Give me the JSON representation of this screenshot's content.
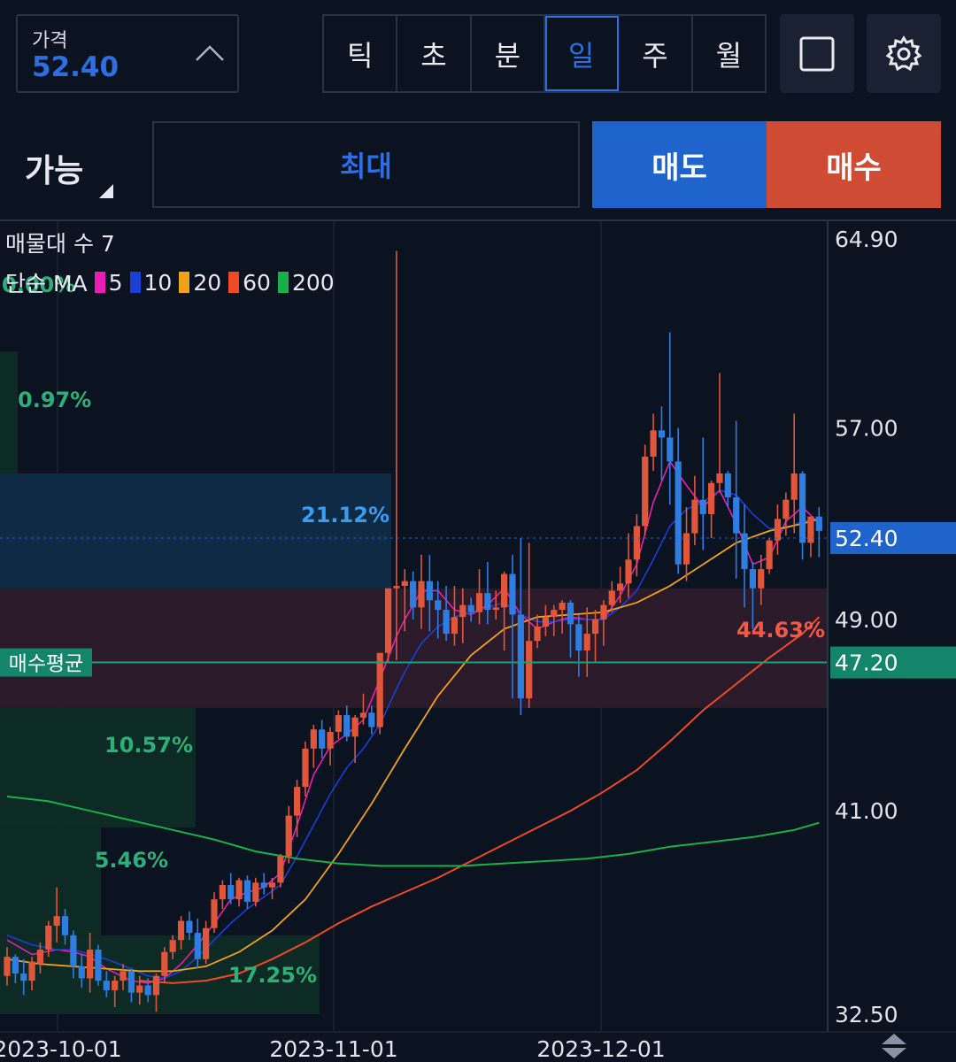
{
  "price_box": {
    "label": "가격",
    "value": "52.40"
  },
  "periods": [
    {
      "label": "틱",
      "active": false
    },
    {
      "label": "초",
      "active": false
    },
    {
      "label": "분",
      "active": false
    },
    {
      "label": "일",
      "active": true
    },
    {
      "label": "주",
      "active": false
    },
    {
      "label": "월",
      "active": false
    }
  ],
  "order": {
    "available_label": "가능",
    "max_label": "최대",
    "sell_label": "매도",
    "buy_label": "매수"
  },
  "legend": {
    "volume_profile": "매물대 수 7",
    "ma_label": "단순 MA",
    "ma_periods": [
      {
        "period": "5",
        "color": "#e91eb4"
      },
      {
        "period": "10",
        "color": "#1a3fd6"
      },
      {
        "period": "20",
        "color": "#f0a21a"
      },
      {
        "period": "60",
        "color": "#ef4a26"
      },
      {
        "period": "200",
        "color": "#18b04a"
      }
    ]
  },
  "colors": {
    "up": "#e0563a",
    "down": "#2f7de0",
    "accent": "#2d6fe0",
    "current_price_bg": "#1f64cc",
    "avg_price_bg": "#12856a"
  },
  "chart_data": {
    "type": "candlestick",
    "y_axis_ticks": [
      "64.90",
      "57.00",
      "49.00",
      "41.00",
      "32.50"
    ],
    "ylim": [
      32.5,
      64.9
    ],
    "x_axis_ticks": [
      "2023-10-01",
      "2023-11-01",
      "2023-12-01"
    ],
    "current_price": "52.40",
    "average_buy_price": {
      "label": "매수평균",
      "value": "47.20"
    },
    "volume_profile_labels": [
      "0.00%",
      "0.97%",
      "21.12%",
      "44.63%",
      "10.57%",
      "5.46%",
      "17.25%"
    ],
    "volume_profile": [
      {
        "from": 60.2,
        "to": 64.9,
        "percent": "0.00%",
        "color": "#0e2a24"
      },
      {
        "from": 55.1,
        "to": 60.2,
        "percent": "0.97%",
        "color": "#0e2a24"
      },
      {
        "from": 50.3,
        "to": 55.1,
        "percent": "21.12%",
        "color": "#0f2a45"
      },
      {
        "from": 45.3,
        "to": 50.3,
        "percent": "44.63%",
        "color": "#2a1a2a"
      },
      {
        "from": 40.3,
        "to": 45.3,
        "percent": "10.57%",
        "color": "#0e2a24"
      },
      {
        "from": 35.8,
        "to": 40.3,
        "percent": "5.46%",
        "color": "#0e2a24"
      },
      {
        "from": 32.5,
        "to": 35.8,
        "percent": "17.25%",
        "color": "#0e2a24"
      }
    ],
    "candles": [
      [
        34.1,
        35.3,
        33.7,
        34.9
      ],
      [
        34.9,
        35.0,
        33.8,
        34.2
      ],
      [
        34.2,
        34.8,
        33.3,
        33.9
      ],
      [
        33.9,
        34.9,
        33.5,
        34.7
      ],
      [
        34.6,
        35.5,
        34.2,
        35.2
      ],
      [
        35.2,
        36.4,
        34.9,
        36.2
      ],
      [
        36.2,
        37.8,
        35.5,
        36.6
      ],
      [
        36.6,
        36.9,
        35.4,
        35.8
      ],
      [
        35.8,
        36.0,
        34.0,
        34.5
      ],
      [
        34.5,
        35.0,
        33.6,
        34.0
      ],
      [
        34.0,
        35.9,
        33.4,
        35.2
      ],
      [
        35.2,
        35.4,
        33.7,
        33.9
      ],
      [
        33.9,
        34.3,
        33.2,
        33.5
      ],
      [
        33.5,
        34.1,
        32.8,
        33.9
      ],
      [
        33.9,
        34.6,
        33.5,
        34.3
      ],
      [
        34.3,
        34.4,
        33.0,
        33.4
      ],
      [
        33.4,
        34.1,
        32.9,
        33.7
      ],
      [
        33.7,
        34.0,
        33.0,
        33.3
      ],
      [
        33.3,
        34.2,
        32.6,
        34.1
      ],
      [
        34.1,
        35.3,
        33.8,
        35.1
      ],
      [
        35.1,
        35.8,
        34.8,
        35.6
      ],
      [
        35.6,
        36.6,
        35.2,
        36.4
      ],
      [
        36.4,
        36.8,
        35.6,
        35.9
      ],
      [
        35.9,
        36.5,
        34.4,
        34.8
      ],
      [
        34.8,
        36.4,
        34.6,
        36.1
      ],
      [
        36.1,
        37.6,
        35.9,
        37.3
      ],
      [
        37.3,
        38.1,
        36.9,
        37.9
      ],
      [
        37.9,
        38.4,
        37.1,
        37.3
      ],
      [
        37.3,
        38.2,
        37.0,
        38.1
      ],
      [
        38.1,
        38.3,
        36.9,
        37.2
      ],
      [
        37.2,
        38.2,
        37.0,
        38.0
      ],
      [
        38.0,
        38.4,
        37.5,
        37.8
      ],
      [
        37.8,
        38.2,
        37.3,
        38.0
      ],
      [
        38.0,
        39.2,
        37.8,
        39.1
      ],
      [
        39.1,
        41.2,
        38.8,
        40.8
      ],
      [
        40.8,
        42.3,
        39.9,
        42.0
      ],
      [
        42.0,
        43.9,
        41.6,
        43.6
      ],
      [
        43.6,
        44.6,
        42.8,
        44.4
      ],
      [
        44.4,
        44.8,
        43.2,
        43.6
      ],
      [
        43.6,
        44.5,
        42.9,
        44.3
      ],
      [
        44.3,
        45.2,
        44.0,
        45.0
      ],
      [
        45.0,
        45.4,
        43.9,
        44.1
      ],
      [
        44.1,
        45.0,
        43.0,
        44.9
      ],
      [
        44.9,
        45.9,
        44.6,
        45.1
      ],
      [
        45.1,
        45.4,
        44.2,
        44.5
      ],
      [
        44.5,
        47.6,
        44.2,
        47.6
      ],
      [
        47.6,
        50.3,
        47.2,
        50.3
      ],
      [
        50.3,
        64.4,
        47.3,
        50.4
      ],
      [
        50.4,
        51.1,
        48.5,
        50.6
      ],
      [
        50.6,
        51.0,
        49.0,
        49.5
      ],
      [
        49.5,
        51.7,
        48.6,
        50.6
      ],
      [
        50.6,
        51.7,
        48.5,
        49.8
      ],
      [
        49.8,
        50.6,
        48.2,
        49.4
      ],
      [
        49.4,
        50.4,
        48.1,
        48.4
      ],
      [
        48.4,
        50.4,
        47.9,
        49.1
      ],
      [
        49.1,
        50.3,
        48.0,
        49.6
      ],
      [
        49.6,
        49.9,
        48.9,
        49.3
      ],
      [
        49.3,
        51.1,
        48.8,
        50.1
      ],
      [
        50.1,
        51.4,
        48.8,
        49.4
      ],
      [
        49.4,
        50.2,
        49.0,
        49.5
      ],
      [
        49.5,
        51.0,
        47.7,
        50.9
      ],
      [
        50.9,
        51.7,
        45.7,
        49.2
      ],
      [
        49.2,
        52.4,
        45.0,
        45.7
      ],
      [
        45.7,
        52.2,
        45.3,
        48.1
      ],
      [
        48.1,
        49.2,
        47.8,
        48.7
      ],
      [
        48.7,
        49.6,
        48.3,
        49.1
      ],
      [
        49.1,
        49.6,
        48.3,
        49.4
      ],
      [
        49.4,
        49.8,
        48.4,
        49.7
      ],
      [
        49.7,
        49.8,
        47.4,
        48.8
      ],
      [
        48.8,
        49.2,
        46.6,
        47.7
      ],
      [
        47.7,
        49.5,
        46.6,
        48.4
      ],
      [
        48.4,
        49.4,
        47.2,
        49.0
      ],
      [
        49.0,
        49.8,
        47.9,
        49.6
      ],
      [
        49.6,
        50.6,
        49.3,
        50.2
      ],
      [
        50.2,
        51.2,
        49.7,
        50.5
      ],
      [
        50.5,
        52.6,
        49.9,
        51.5
      ],
      [
        51.5,
        53.4,
        50.8,
        52.9
      ],
      [
        52.9,
        56.3,
        52.5,
        55.8
      ],
      [
        55.8,
        57.6,
        55.2,
        56.9
      ],
      [
        56.9,
        57.9,
        54.8,
        56.6
      ],
      [
        56.6,
        61.0,
        53.8,
        55.6
      ],
      [
        55.6,
        57.0,
        50.9,
        51.3
      ],
      [
        51.3,
        53.7,
        50.6,
        52.6
      ],
      [
        52.6,
        55.0,
        52.1,
        54.0
      ],
      [
        54.0,
        56.6,
        51.9,
        53.4
      ],
      [
        53.4,
        54.8,
        52.4,
        54.7
      ],
      [
        54.7,
        59.3,
        54.3,
        55.1
      ],
      [
        55.1,
        55.2,
        53.7,
        54.1
      ],
      [
        54.1,
        57.3,
        50.7,
        52.6
      ],
      [
        52.6,
        53.8,
        49.5,
        51.1
      ],
      [
        51.1,
        51.4,
        48.6,
        50.3
      ],
      [
        50.3,
        51.7,
        49.6,
        51.1
      ],
      [
        51.1,
        52.4,
        50.9,
        52.3
      ],
      [
        52.3,
        53.8,
        51.7,
        53.2
      ],
      [
        53.2,
        54.3,
        52.5,
        54.0
      ],
      [
        54.0,
        57.6,
        52.6,
        55.1
      ],
      [
        55.1,
        55.2,
        51.5,
        52.2
      ],
      [
        52.2,
        53.0,
        51.6,
        53.3
      ],
      [
        53.3,
        53.7,
        51.6,
        52.7
      ]
    ],
    "moving_averages": {
      "ma5": [
        [
          0,
          35.6
        ],
        [
          3,
          35.0
        ],
        [
          6,
          35.2
        ],
        [
          8,
          35.1
        ],
        [
          10,
          34.9
        ],
        [
          12,
          34.4
        ],
        [
          15,
          33.9
        ],
        [
          17,
          33.8
        ],
        [
          19,
          34.0
        ],
        [
          21,
          34.6
        ],
        [
          23,
          35.4
        ],
        [
          25,
          36.3
        ],
        [
          27,
          37.3
        ],
        [
          29,
          37.6
        ],
        [
          31,
          37.8
        ],
        [
          33,
          38.4
        ],
        [
          35,
          40.4
        ],
        [
          37,
          42.5
        ],
        [
          39,
          43.7
        ],
        [
          41,
          44.2
        ],
        [
          43,
          44.8
        ],
        [
          45,
          46.5
        ],
        [
          47,
          48.3
        ],
        [
          48,
          49.0
        ],
        [
          50,
          50.2
        ],
        [
          52,
          50.2
        ],
        [
          54,
          49.4
        ],
        [
          56,
          49.2
        ],
        [
          58,
          49.6
        ],
        [
          60,
          50.3
        ],
        [
          62,
          49.2
        ],
        [
          64,
          48.6
        ],
        [
          66,
          48.9
        ],
        [
          68,
          49.1
        ],
        [
          70,
          49.0
        ],
        [
          72,
          49.0
        ],
        [
          74,
          50.0
        ],
        [
          76,
          51.3
        ],
        [
          78,
          53.9
        ],
        [
          80,
          55.6
        ],
        [
          82,
          54.6
        ],
        [
          84,
          53.7
        ],
        [
          86,
          54.4
        ],
        [
          88,
          53.0
        ],
        [
          90,
          51.3
        ],
        [
          92,
          51.6
        ],
        [
          94,
          53.1
        ],
        [
          96,
          53.7
        ],
        [
          98,
          53.0
        ]
      ],
      "ma10": [
        [
          0,
          35.8
        ],
        [
          3,
          35.4
        ],
        [
          6,
          35.2
        ],
        [
          8,
          35.2
        ],
        [
          10,
          35.0
        ],
        [
          12,
          34.8
        ],
        [
          15,
          34.4
        ],
        [
          17,
          34.1
        ],
        [
          19,
          34.0
        ],
        [
          21,
          34.3
        ],
        [
          23,
          34.9
        ],
        [
          25,
          35.6
        ],
        [
          27,
          36.3
        ],
        [
          29,
          36.9
        ],
        [
          31,
          37.4
        ],
        [
          33,
          37.9
        ],
        [
          35,
          39.1
        ],
        [
          37,
          40.4
        ],
        [
          39,
          41.7
        ],
        [
          41,
          42.8
        ],
        [
          43,
          43.6
        ],
        [
          45,
          44.6
        ],
        [
          47,
          46.1
        ],
        [
          48,
          46.8
        ],
        [
          50,
          48.0
        ],
        [
          52,
          48.7
        ],
        [
          54,
          49.1
        ],
        [
          56,
          49.3
        ],
        [
          58,
          49.5
        ],
        [
          60,
          49.7
        ],
        [
          62,
          49.2
        ],
        [
          64,
          48.9
        ],
        [
          66,
          48.9
        ],
        [
          68,
          49.0
        ],
        [
          70,
          49.0
        ],
        [
          72,
          49.0
        ],
        [
          74,
          49.5
        ],
        [
          76,
          50.2
        ],
        [
          78,
          51.5
        ],
        [
          80,
          52.9
        ],
        [
          82,
          53.6
        ],
        [
          84,
          53.9
        ],
        [
          86,
          54.4
        ],
        [
          88,
          54.2
        ],
        [
          90,
          53.4
        ],
        [
          92,
          52.8
        ],
        [
          94,
          52.8
        ],
        [
          96,
          53.1
        ],
        [
          98,
          53.2
        ]
      ],
      "ma20": [
        [
          0,
          34.8
        ],
        [
          4,
          34.6
        ],
        [
          8,
          34.5
        ],
        [
          12,
          34.4
        ],
        [
          16,
          34.3
        ],
        [
          20,
          34.3
        ],
        [
          24,
          34.5
        ],
        [
          28,
          35.1
        ],
        [
          32,
          36.0
        ],
        [
          36,
          37.3
        ],
        [
          40,
          39.2
        ],
        [
          44,
          41.3
        ],
        [
          48,
          43.6
        ],
        [
          52,
          45.8
        ],
        [
          56,
          47.5
        ],
        [
          60,
          48.6
        ],
        [
          64,
          49.1
        ],
        [
          68,
          49.2
        ],
        [
          72,
          49.3
        ],
        [
          76,
          49.7
        ],
        [
          80,
          50.4
        ],
        [
          84,
          51.3
        ],
        [
          88,
          52.2
        ],
        [
          92,
          52.7
        ],
        [
          96,
          53.0
        ],
        [
          98,
          53.2
        ]
      ],
      "ma60": [
        [
          16,
          33.9
        ],
        [
          20,
          33.8
        ],
        [
          24,
          33.9
        ],
        [
          28,
          34.2
        ],
        [
          32,
          34.8
        ],
        [
          36,
          35.5
        ],
        [
          40,
          36.3
        ],
        [
          44,
          37.0
        ],
        [
          48,
          37.6
        ],
        [
          52,
          38.2
        ],
        [
          56,
          38.9
        ],
        [
          60,
          39.6
        ],
        [
          64,
          40.3
        ],
        [
          68,
          41.0
        ],
        [
          72,
          41.8
        ],
        [
          76,
          42.7
        ],
        [
          80,
          43.9
        ],
        [
          84,
          45.2
        ],
        [
          88,
          46.3
        ],
        [
          92,
          47.4
        ],
        [
          96,
          48.4
        ],
        [
          98,
          49.1
        ]
      ],
      "ma200": [
        [
          0,
          41.6
        ],
        [
          5,
          41.4
        ],
        [
          10,
          41.0
        ],
        [
          15,
          40.6
        ],
        [
          20,
          40.2
        ],
        [
          25,
          39.8
        ],
        [
          30,
          39.3
        ],
        [
          35,
          39.0
        ],
        [
          40,
          38.8
        ],
        [
          45,
          38.7
        ],
        [
          50,
          38.7
        ],
        [
          55,
          38.7
        ],
        [
          60,
          38.8
        ],
        [
          65,
          38.9
        ],
        [
          70,
          39.0
        ],
        [
          75,
          39.2
        ],
        [
          80,
          39.5
        ],
        [
          85,
          39.7
        ],
        [
          90,
          39.9
        ],
        [
          95,
          40.2
        ],
        [
          98,
          40.5
        ]
      ]
    }
  }
}
